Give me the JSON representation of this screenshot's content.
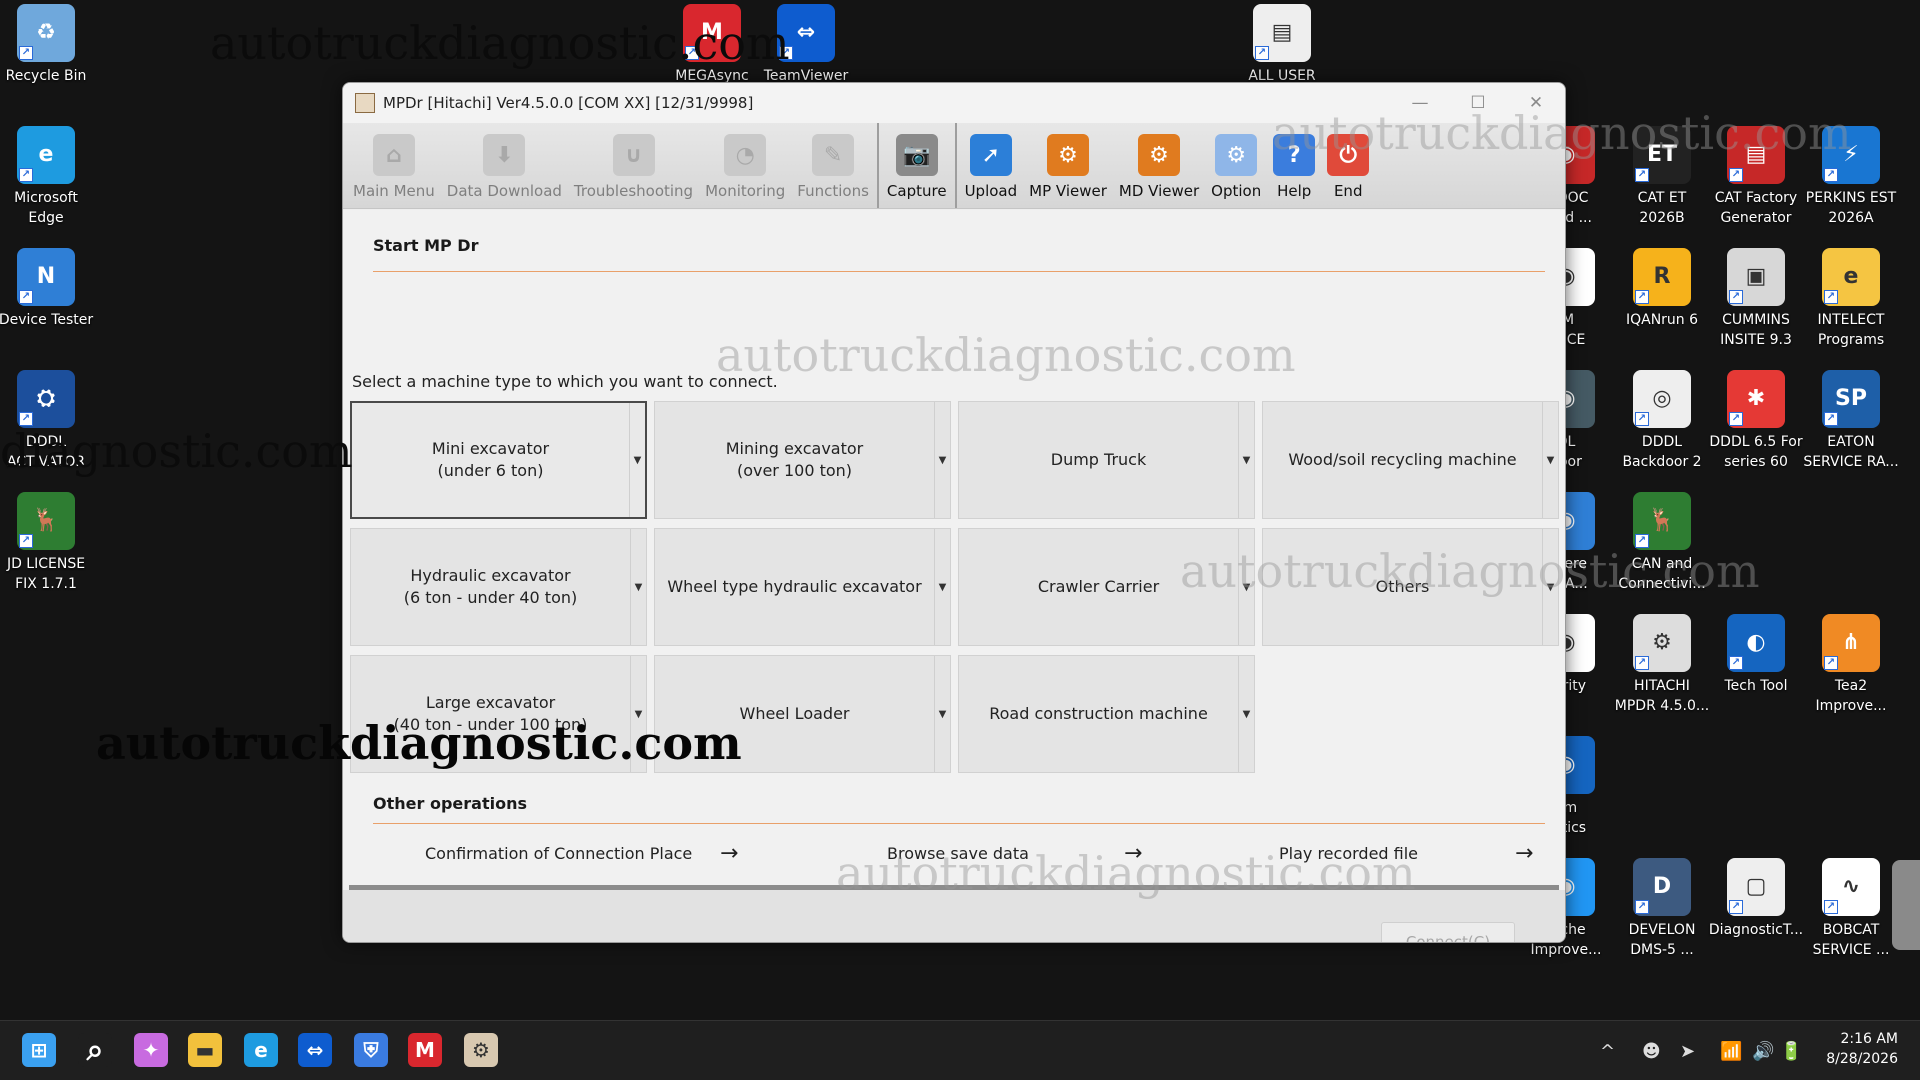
{
  "desktop": {
    "watermark": "autotruckdiagnostic.com",
    "watermark_partial": "diagnostic.com",
    "icons_left": [
      {
        "label": "Recycle Bin",
        "icon": "recycle-bin-icon",
        "color": "#6fa8dc"
      },
      {
        "label": "Microsoft Edge",
        "icon": "edge-icon",
        "color": "#1e9be0"
      },
      {
        "label": "Device Tester",
        "icon": "device-tester-icon",
        "color": "#2f7fd6"
      },
      {
        "label": "DDDL ACTIVATOR",
        "icon": "dddl-activator-icon",
        "color": "#1c4f9c"
      },
      {
        "label": "JD LICENSE FIX 1.7.1",
        "icon": "jd-license-icon",
        "color": "#2e7d32"
      }
    ],
    "icons_top": [
      {
        "label": "MEGAsync",
        "icon": "mega-icon",
        "color": "#d9272e"
      },
      {
        "label": "TeamViewer",
        "icon": "teamviewer-icon",
        "color": "#0e5ccf"
      },
      {
        "label": "ALL USER",
        "icon": "document-icon",
        "color": "#eeeeee"
      }
    ],
    "icons_right_col1": [
      {
        "label": "n DOC\nnced ...",
        "icon": "doc-icon",
        "color": "#c62828"
      },
      {
        "label": "IM\nAGCE",
        "icon": "agce-icon",
        "color": "#ffffff"
      },
      {
        "label": "DL\ndoor",
        "icon": "backdoor-icon",
        "color": "#455a64"
      },
      {
        "label": "Deere\nce A...",
        "icon": "deere-icon",
        "color": "#2f7fd6"
      },
      {
        "label": "curity",
        "icon": "security-icon",
        "color": "#ffffff"
      },
      {
        "label": "om\nostics",
        "icon": "diagnostics-icon",
        "color": "#1565c0"
      },
      {
        "label": "tache\nImprove...",
        "icon": "attache-icon",
        "color": "#2196f3"
      }
    ],
    "icons_right_col2": [
      {
        "label": "CAT ET 2026B",
        "icon": "cat-et-icon",
        "color": "#222222",
        "glyph": "ET"
      },
      {
        "label": "IQANrun 6",
        "icon": "iqan-icon",
        "color": "#f6b21b",
        "glyph": "R"
      },
      {
        "label": "DDDL Backdoor 2",
        "icon": "dddl-backdoor-icon",
        "color": "#eeeeee",
        "glyph": "◎"
      },
      {
        "label": "CAN and Connectivi...",
        "icon": "can-icon",
        "color": "#2e7d32",
        "glyph": "🦌"
      },
      {
        "label": "HITACHI MPDR 4.5.0...",
        "icon": "hitachi-icon",
        "color": "#dddddd",
        "glyph": "⚙"
      },
      {
        "label": "DEVELON DMS-5 ...",
        "icon": "develon-icon",
        "color": "#3d5a80",
        "glyph": "D"
      }
    ],
    "icons_right_col3": [
      {
        "label": "CAT Factory Generator",
        "icon": "cat-factory-icon",
        "color": "#c62828",
        "glyph": "▤"
      },
      {
        "label": "CUMMINS INSITE 9.3",
        "icon": "cummins-icon",
        "color": "#d7d7d7",
        "glyph": "▣"
      },
      {
        "label": "DDDL 6.5 For series 60",
        "icon": "dddl65-icon",
        "color": "#e53935",
        "glyph": "✱"
      },
      {
        "label": "Tech Tool",
        "icon": "techtool-icon",
        "color": "#1565c0",
        "glyph": "◐"
      },
      {
        "label": "DiagnosticT...",
        "icon": "diagnostic-tool-icon",
        "color": "#eeeeee",
        "glyph": "▢"
      }
    ],
    "icons_right_col4": [
      {
        "label": "PERKINS EST 2026A",
        "icon": "perkins-icon",
        "color": "#1976d2",
        "glyph": "⚡"
      },
      {
        "label": "INTELECT Programs",
        "icon": "intelect-icon",
        "color": "#f5c542",
        "glyph": "e"
      },
      {
        "label": "EATON SERVICE RA...",
        "icon": "eaton-icon",
        "color": "#1e5fa8",
        "glyph": "SP"
      },
      {
        "label": "Tea2 Improve...",
        "icon": "tea2-icon",
        "color": "#f08a24",
        "glyph": "⋔"
      },
      {
        "label": "BOBCAT SERVICE ...",
        "icon": "bobcat-icon",
        "color": "#ffffff",
        "glyph": "∿"
      }
    ]
  },
  "window": {
    "title": "MPDr [Hitachi] Ver4.5.0.0 [COM XX] [12/31/9998]",
    "controls": {
      "minimize": "—",
      "maximize": "☐",
      "close": "✕"
    },
    "toolbar": [
      {
        "label": "Main Menu",
        "icon": "main-menu-icon",
        "enabled": false,
        "glyph": "⌂"
      },
      {
        "label": "Data Download",
        "icon": "data-download-icon",
        "enabled": false,
        "glyph": "⬇"
      },
      {
        "label": "Troubleshooting",
        "icon": "stethoscope-icon",
        "enabled": false,
        "glyph": "∪"
      },
      {
        "label": "Monitoring",
        "icon": "gauge-icon",
        "enabled": false,
        "glyph": "◔"
      },
      {
        "label": "Functions",
        "icon": "functions-icon",
        "enabled": false,
        "glyph": "✎"
      },
      {
        "label": "Capture",
        "icon": "camera-icon",
        "enabled": true,
        "glyph": "📷",
        "color": "#8a8a8a"
      },
      {
        "label": "Upload",
        "icon": "upload-icon",
        "enabled": true,
        "glyph": "➚",
        "color": "#2c7fd8"
      },
      {
        "label": "MP Viewer",
        "icon": "mp-viewer-icon",
        "enabled": true,
        "glyph": "⚙",
        "color": "#e07b1f"
      },
      {
        "label": "MD Viewer",
        "icon": "md-viewer-icon",
        "enabled": true,
        "glyph": "⚙",
        "color": "#e07b1f"
      },
      {
        "label": "Option",
        "icon": "option-gear-icon",
        "enabled": true,
        "glyph": "⚙",
        "color": "#8fb6e8"
      },
      {
        "label": "Help",
        "icon": "help-icon",
        "enabled": true,
        "glyph": "?",
        "color": "#3b7ddd"
      },
      {
        "label": "End",
        "icon": "power-icon",
        "enabled": true,
        "glyph": "⏻",
        "color": "#e04a3a"
      }
    ],
    "start": {
      "title": "Start MP Dr",
      "instruction": "Select a machine type to which you want to connect."
    },
    "machines": [
      {
        "label": "Mini excavator\n(under 6 ton)",
        "selected": true
      },
      {
        "label": "Mining excavator\n(over 100 ton)",
        "selected": false
      },
      {
        "label": "Dump Truck",
        "selected": false
      },
      {
        "label": "Wood/soil recycling machine",
        "selected": false
      },
      {
        "label": "Hydraulic excavator\n(6 ton - under 40 ton)",
        "selected": false
      },
      {
        "label": "Wheel type hydraulic excavator",
        "selected": false
      },
      {
        "label": "Crawler Carrier",
        "selected": false
      },
      {
        "label": "Others",
        "selected": false
      },
      {
        "label": "Large excavator\n(40 ton - under 100 ton)",
        "selected": false
      },
      {
        "label": "Wheel Loader",
        "selected": false
      },
      {
        "label": "Road construction machine",
        "selected": false
      }
    ],
    "other_ops": {
      "title": "Other operations",
      "items": [
        {
          "label": "Confirmation of Connection Place",
          "arrow": "→"
        },
        {
          "label": "Browse save data",
          "arrow": "→"
        },
        {
          "label": "Play recorded file",
          "arrow": "→"
        }
      ]
    },
    "connect_label": "Connect(C)"
  },
  "taskbar": {
    "apps": [
      {
        "icon": "windows-start-icon",
        "glyph": "⊞",
        "color": "#3aa0f0"
      },
      {
        "icon": "search-icon",
        "glyph": "⌕",
        "color": "#1f1f1f"
      },
      {
        "icon": "copilot-icon",
        "glyph": "✦",
        "color": "#c86be0"
      },
      {
        "icon": "file-explorer-icon",
        "glyph": "▬",
        "color": "#f2c13c"
      },
      {
        "icon": "edge-icon",
        "glyph": "e",
        "color": "#1e9be0"
      },
      {
        "icon": "teamviewer-icon",
        "glyph": "⇔",
        "color": "#0e5ccf"
      },
      {
        "icon": "security-shield-icon",
        "glyph": "⛨",
        "color": "#3a7be0"
      },
      {
        "icon": "mega-icon",
        "glyph": "M",
        "color": "#d9272e"
      },
      {
        "icon": "hitachi-mpdr-icon",
        "glyph": "⚙",
        "color": "#d8c8b0"
      }
    ],
    "tray": [
      "^",
      "☻",
      "➤",
      "📶",
      "🔊",
      "🔋"
    ],
    "time": "2:16 AM",
    "date": "8/28/2026"
  }
}
